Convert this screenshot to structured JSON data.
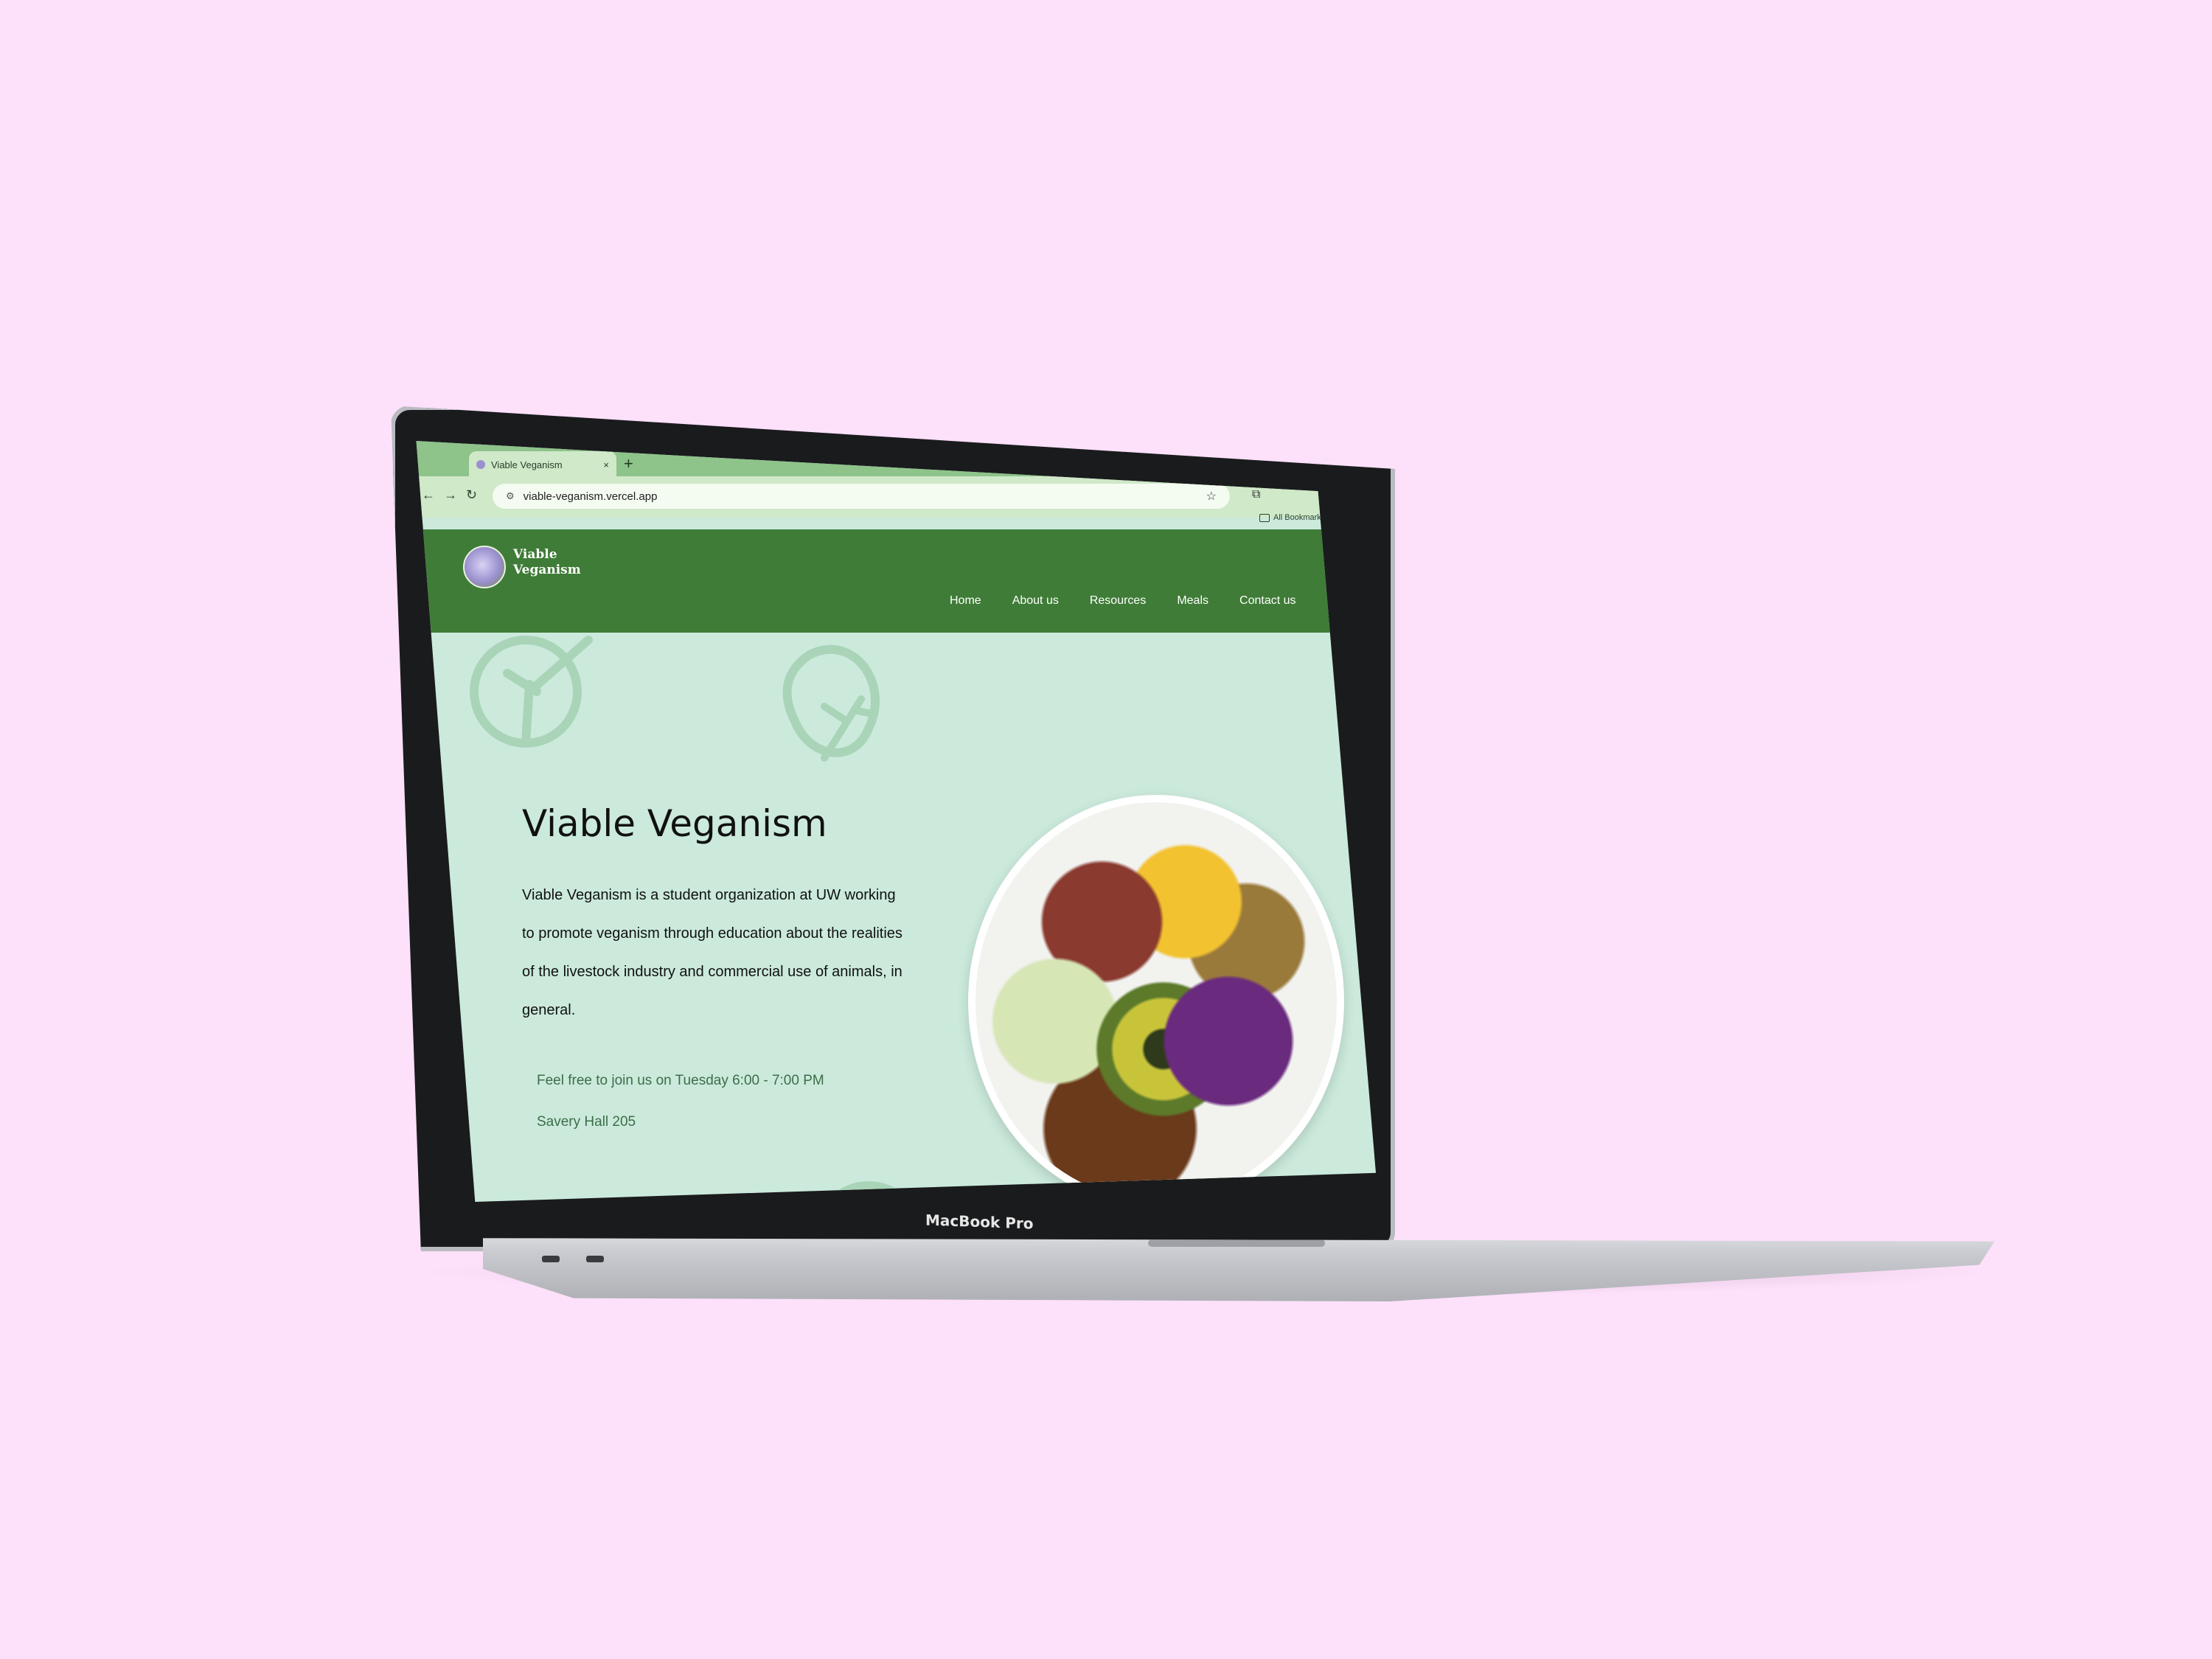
{
  "colors": {
    "background": "#fde0fa",
    "browser_chrome": "#8ec38a",
    "site_header": "#3f7c37",
    "hero_bg": "#cbeadc",
    "meeting_text": "#3d6d48"
  },
  "device": {
    "label": "MacBook Pro"
  },
  "browser": {
    "tab_title": "Viable Veganism",
    "url": "viable-veganism.vercel.app",
    "bookmarks_label": "All Bookmarks",
    "icons": [
      "back-icon",
      "forward-icon",
      "reload-icon",
      "site-info-icon",
      "star-icon",
      "extensions-icon",
      "folder-icon"
    ]
  },
  "site": {
    "brand": "Viable Veganism",
    "nav": [
      "Home",
      "About us",
      "Resources",
      "Meals",
      "Contact us"
    ],
    "hero": {
      "title": "Viable Veganism",
      "description": "Viable Veganism is a student organization at UW working to promote veganism through education about the realities of the livestock industry and commercial use of animals, in general.",
      "meeting_time": "Feel free to join us on Tuesday 6:00 - 7:00 PM",
      "meeting_place": "Savery Hall 205"
    }
  }
}
